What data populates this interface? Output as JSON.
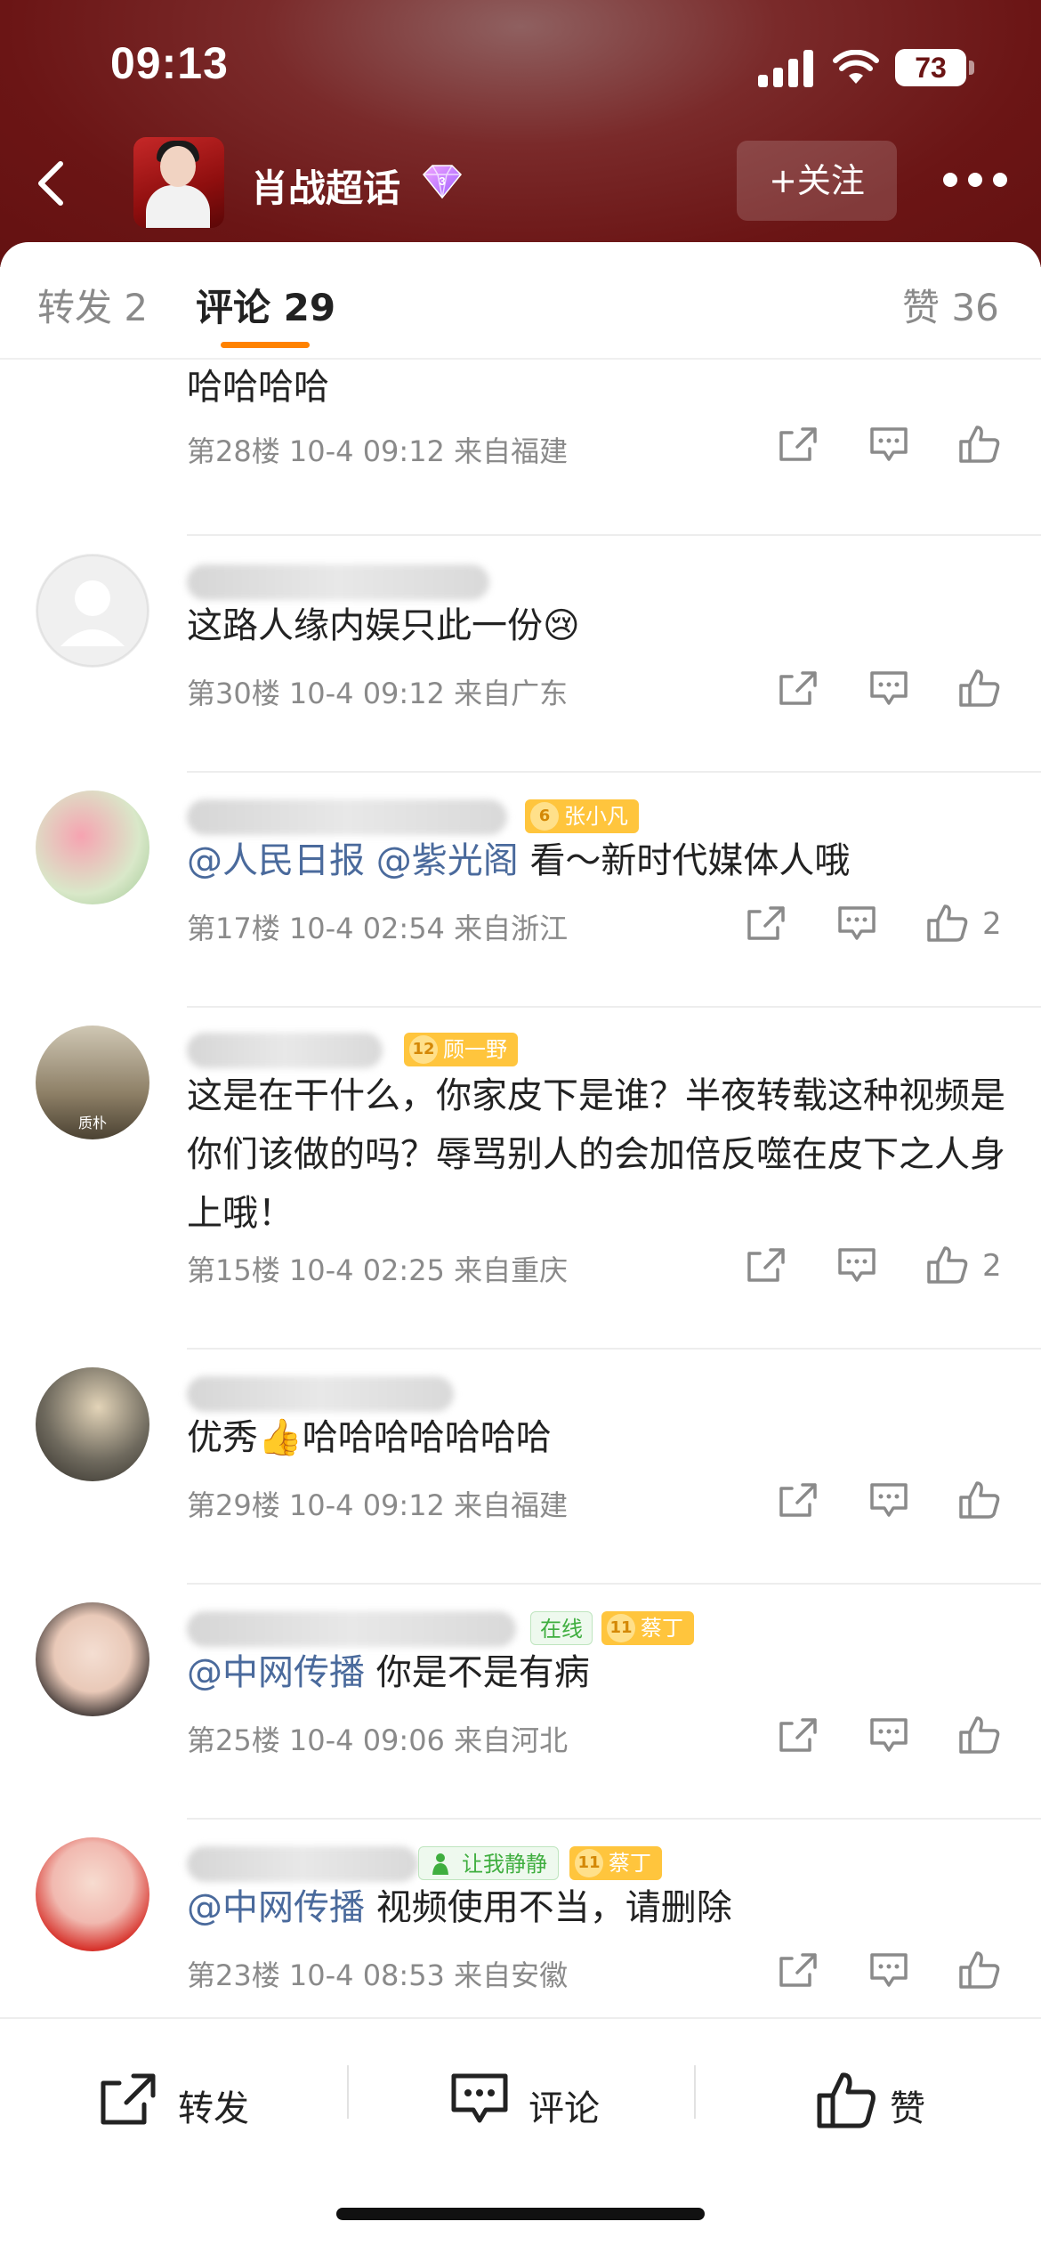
{
  "status_bar": {
    "time": "09:13",
    "battery": "73"
  },
  "header": {
    "group_name": "肖战超话",
    "follow_label": "+关注"
  },
  "tabs": [
    {
      "label": "转发 2"
    },
    {
      "label": "评论 29"
    },
    {
      "label": "赞 36"
    }
  ],
  "comments": [
    {
      "text": "哈哈哈哈",
      "meta": "第28楼 10-4 09:12 来自福建",
      "likes": ""
    },
    {
      "text": "这路人缘内娱只此一份😢",
      "meta": "第30楼 10-4 09:12 来自广东",
      "likes": ""
    },
    {
      "mentions": [
        "@人民日报",
        "@紫光阁"
      ],
      "text": "看～新时代媒体人哦",
      "badge": {
        "level": "6",
        "name": "张小凡"
      },
      "meta": "第17楼 10-4 02:54 来自浙江",
      "likes": "2"
    },
    {
      "text": "这是在干什么，你家皮下是谁？半夜转载这种视频是你们该做的吗？辱骂别人的会加倍反噬在皮下之人身上哦！",
      "badge": {
        "level": "12",
        "name": "顾一野"
      },
      "avatar_caption": "质朴",
      "meta": "第15楼 10-4 02:25 来自重庆",
      "likes": "2"
    },
    {
      "text": "优秀👍哈哈哈哈哈哈哈",
      "meta": "第29楼 10-4 09:12 来自福建",
      "likes": ""
    },
    {
      "mentions": [
        "@中网传播"
      ],
      "text": "你是不是有病",
      "online_label": "在线",
      "badge": {
        "level": "11",
        "name": "蔡丁"
      },
      "meta": "第25楼 10-4 09:06 来自河北",
      "likes": ""
    },
    {
      "mentions": [
        "@中网传播"
      ],
      "text": "视频使用不当，请删除",
      "status_label": "让我静静",
      "badge": {
        "level": "11",
        "name": "蔡丁"
      },
      "meta": "第23楼 10-4 08:53 来自安徽",
      "likes": ""
    }
  ],
  "bottom_bar": {
    "repost_label": "转发",
    "comment_label": "评论",
    "like_label": "赞"
  },
  "colors": {
    "header_bg": "#6b1515",
    "accent": "#ff8200",
    "mention": "#4a6a9c",
    "meta_text": "#8a8a8a",
    "badge_gold": "#ffc53d"
  }
}
